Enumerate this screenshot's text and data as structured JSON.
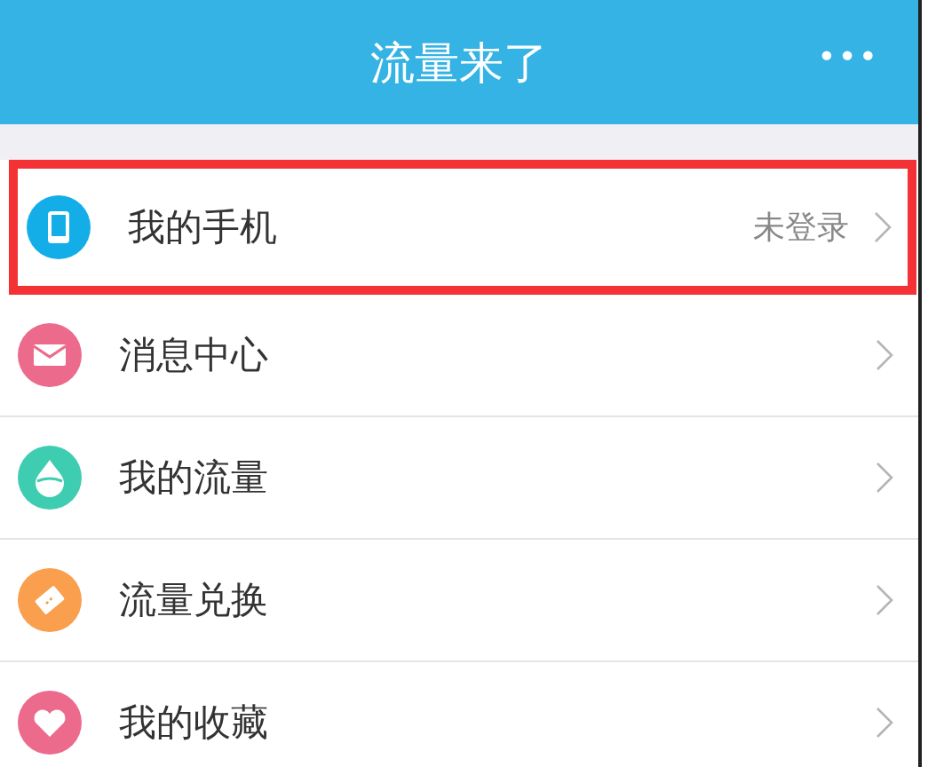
{
  "header": {
    "title": "流量来了",
    "more": "•••"
  },
  "menu": [
    {
      "label": "我的手机",
      "kind": "phone",
      "color": "#13aee8",
      "status": "未登录",
      "highlighted": true
    },
    {
      "label": "消息中心",
      "kind": "mail",
      "color": "#ec6b8d",
      "highlighted": false
    },
    {
      "label": "我的流量",
      "kind": "drop",
      "color": "#3fcdb1",
      "highlighted": false
    },
    {
      "label": "流量兑换",
      "kind": "ticket",
      "color": "#f99f4d",
      "highlighted": false
    },
    {
      "label": "我的收藏",
      "kind": "heart",
      "color": "#ec6b8d",
      "highlighted": false
    }
  ]
}
